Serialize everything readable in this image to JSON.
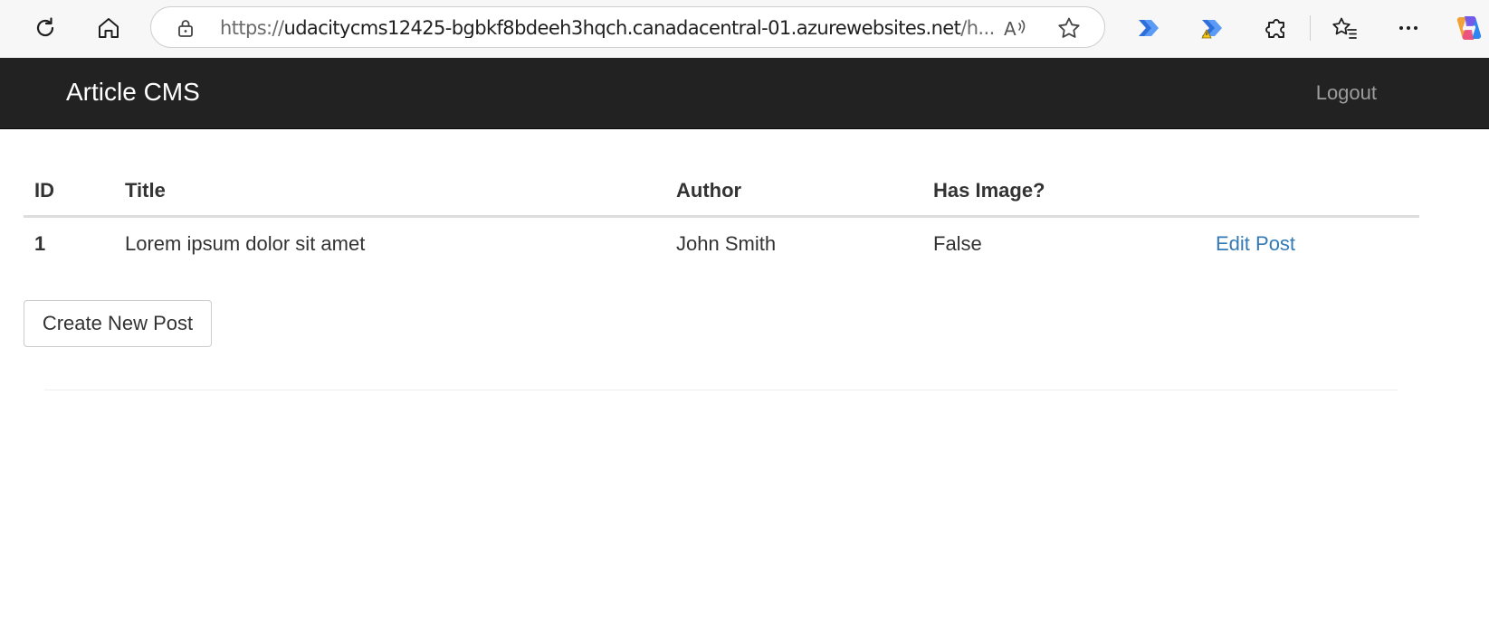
{
  "browser": {
    "url_scheme": "https://",
    "url_host": "udacitycms12425-bgbkf8bdeeh3hqch.canadacentral-01.azurewebsites.net",
    "url_rest": "/h...",
    "icons": {
      "refresh": "refresh-icon",
      "home": "home-icon",
      "site_info": "site-info-lock-icon",
      "read_aloud": "read-aloud-icon",
      "favorite": "star-icon",
      "ext1": "power-automate-icon",
      "ext2": "power-automate-warning-icon",
      "extensions": "puzzle-icon",
      "favorites": "favorites-list-icon",
      "more": "more-icon",
      "copilot": "copilot-icon"
    }
  },
  "navbar": {
    "brand": "Article CMS",
    "logout": "Logout",
    "background": "#222222",
    "link_color": "#9d9d9d"
  },
  "table": {
    "headers": [
      "ID",
      "Title",
      "Author",
      "Has Image?",
      ""
    ],
    "rows": [
      {
        "id": "1",
        "title": "Lorem ipsum dolor sit amet",
        "author": "John Smith",
        "has_image": "False",
        "action": "Edit Post"
      }
    ]
  },
  "actions": {
    "create": "Create New Post"
  },
  "colors": {
    "link": "#337ab7",
    "text": "#333333"
  }
}
